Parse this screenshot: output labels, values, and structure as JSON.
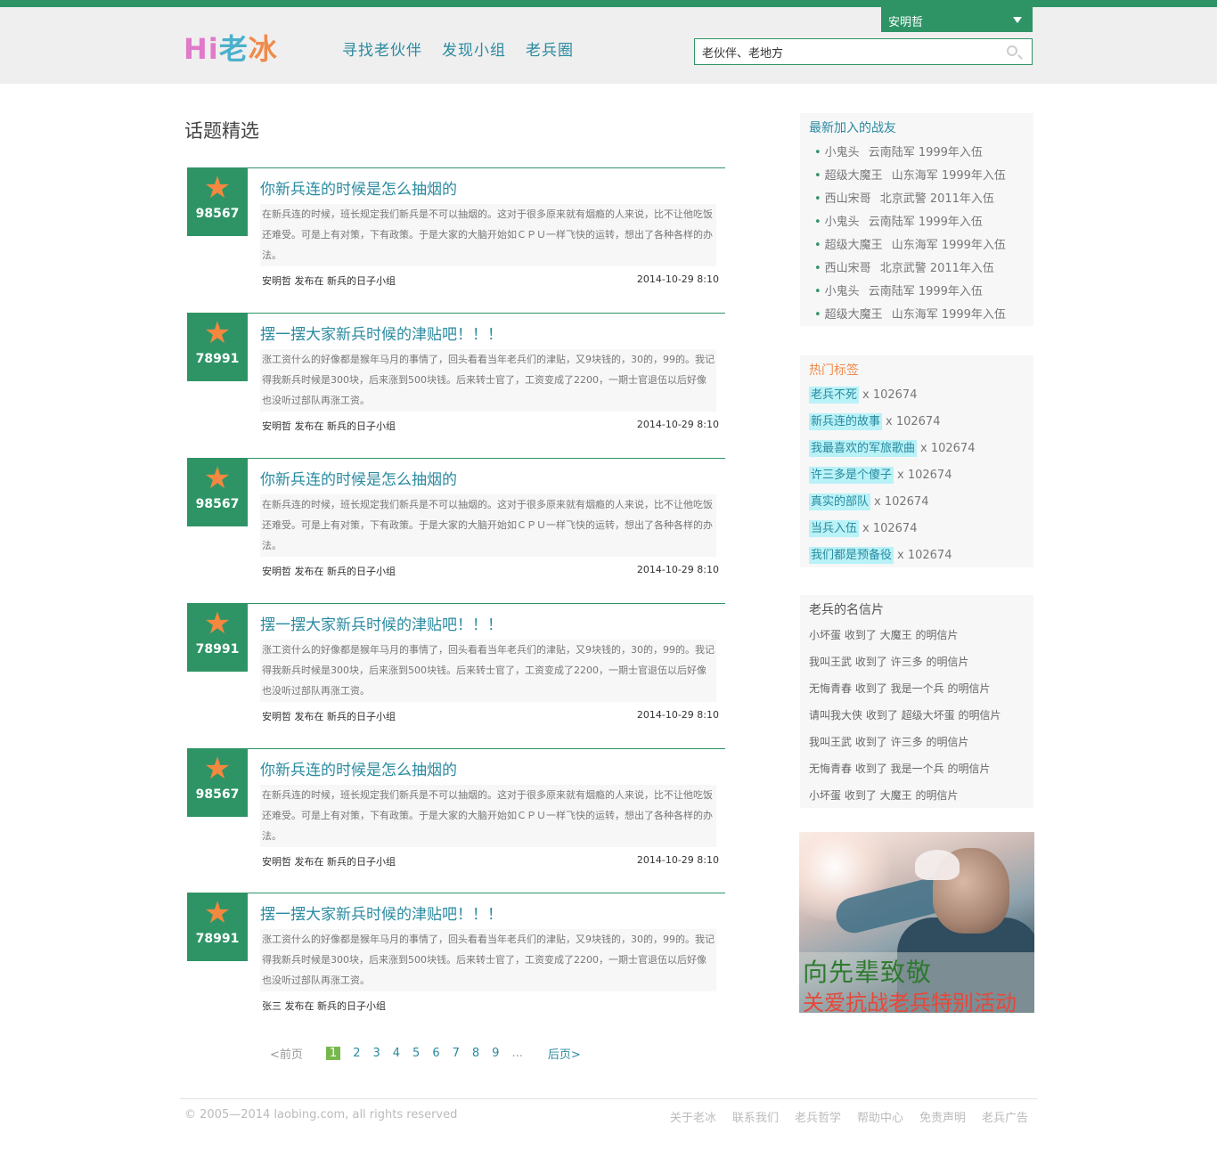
{
  "header": {
    "logo": {
      "hi": "Hi",
      "lao": "老",
      "bing": "冰"
    },
    "nav": [
      "寻找老伙伴",
      "发现小组",
      "老兵圈"
    ],
    "user": "安明哲",
    "search_value": "老伙伴、老地方"
  },
  "main": {
    "section_title": "话题精选",
    "topics": [
      {
        "count": "98567",
        "title": "你新兵连的时候是怎么抽烟的",
        "excerpt": "在新兵连的时候，班长规定我们新兵是不可以抽烟的。这对于很多原来就有烟瘾的人来说，比不让他吃饭还难受。可是上有对策，下有政策。于是大家的大脑开始如ＣＰＵ一样飞快的运转，想出了各种各样的办法。",
        "meta": "安明哲 发布在 新兵的日子小组",
        "date": "2014-10-29 8:10"
      },
      {
        "count": "78991",
        "title": "摆一摆大家新兵时候的津贴吧！！！",
        "excerpt": "涨工资什么的好像都是猴年马月的事情了，回头看看当年老兵们的津贴，又9块钱的，30的，99的。我记得我新兵时候是300块，后来涨到500块钱。后来转士官了，工资变成了2200，一期士官退伍以后好像也没听过部队再涨工资。",
        "meta": "安明哲 发布在 新兵的日子小组",
        "date": "2014-10-29 8:10"
      },
      {
        "count": "98567",
        "title": "你新兵连的时候是怎么抽烟的",
        "excerpt": "在新兵连的时候，班长规定我们新兵是不可以抽烟的。这对于很多原来就有烟瘾的人来说，比不让他吃饭还难受。可是上有对策，下有政策。于是大家的大脑开始如ＣＰＵ一样飞快的运转，想出了各种各样的办法。",
        "meta": "安明哲 发布在 新兵的日子小组",
        "date": "2014-10-29 8:10"
      },
      {
        "count": "78991",
        "title": "摆一摆大家新兵时候的津贴吧！！！",
        "excerpt": "涨工资什么的好像都是猴年马月的事情了，回头看看当年老兵们的津贴，又9块钱的，30的，99的。我记得我新兵时候是300块，后来涨到500块钱。后来转士官了，工资变成了2200，一期士官退伍以后好像也没听过部队再涨工资。",
        "meta": "安明哲 发布在 新兵的日子小组",
        "date": "2014-10-29 8:10"
      },
      {
        "count": "98567",
        "title": "你新兵连的时候是怎么抽烟的",
        "excerpt": "在新兵连的时候，班长规定我们新兵是不可以抽烟的。这对于很多原来就有烟瘾的人来说，比不让他吃饭还难受。可是上有对策，下有政策。于是大家的大脑开始如ＣＰＵ一样飞快的运转，想出了各种各样的办法。",
        "meta": "安明哲 发布在 新兵的日子小组",
        "date": "2014-10-29 8:10"
      },
      {
        "count": "78991",
        "title": "摆一摆大家新兵时候的津贴吧！！！",
        "excerpt": "涨工资什么的好像都是猴年马月的事情了，回头看看当年老兵们的津贴，又9块钱的，30的，99的。我记得我新兵时候是300块，后来涨到500块钱。后来转士官了，工资变成了2200，一期士官退伍以后好像也没听过部队再涨工资。",
        "meta": "张三 发布在 新兵的日子小组",
        "date": ""
      }
    ],
    "pager": {
      "prev": "<前页",
      "pages": [
        "1",
        "2",
        "3",
        "4",
        "5",
        "6",
        "7",
        "8",
        "9"
      ],
      "current": "1",
      "dots": "...",
      "next": "后页>"
    }
  },
  "sidebar": {
    "newest": {
      "title": "最新加入的战友",
      "items": [
        {
          "name": "小鬼头",
          "info": "云南陆军 1999年入伍"
        },
        {
          "name": "超级大魔王",
          "info": "山东海军 1999年入伍"
        },
        {
          "name": "西山宋哥",
          "info": "北京武警 2011年入伍"
        },
        {
          "name": "小鬼头",
          "info": "云南陆军 1999年入伍"
        },
        {
          "name": "超级大魔王",
          "info": "山东海军 1999年入伍"
        },
        {
          "name": "西山宋哥",
          "info": "北京武警 2011年入伍"
        },
        {
          "name": "小鬼头",
          "info": "云南陆军 1999年入伍"
        },
        {
          "name": "超级大魔王",
          "info": "山东海军 1999年入伍"
        }
      ]
    },
    "tags": {
      "title": "热门标签",
      "items": [
        {
          "tag": "老兵不死",
          "count": "x 102674"
        },
        {
          "tag": "新兵连的故事",
          "count": "x 102674"
        },
        {
          "tag": "我最喜欢的军旅歌曲",
          "count": "x 102674"
        },
        {
          "tag": "许三多是个傻子",
          "count": "x 102674"
        },
        {
          "tag": "真实的部队",
          "count": "x 102674"
        },
        {
          "tag": "当兵入伍",
          "count": "x 102674"
        },
        {
          "tag": "我们都是预备役",
          "count": "x 102674"
        }
      ]
    },
    "cards": {
      "title": "老兵的名信片",
      "items": [
        "小坏蛋 收到了 大魔王 的明信片",
        "我叫王武 收到了 许三多 的明信片",
        "无悔青春 收到了 我是一个兵 的明信片",
        "请叫我大侠 收到了 超级大坏蛋 的明信片",
        "我叫王武 收到了 许三多 的明信片",
        "无悔青春 收到了 我是一个兵 的明信片",
        "小坏蛋 收到了 大魔王 的明信片"
      ]
    },
    "banner": {
      "line1": "向先辈致敬",
      "line2": "关爱抗战老兵特别活动"
    }
  },
  "footer": {
    "copyright": "© 2005—2014 laobing.com, all rights reserved",
    "links": [
      "关于老冰",
      "联系我们",
      "老兵哲学",
      "帮助中心",
      "免责声明",
      "老兵广告"
    ]
  },
  "colors": {
    "brand_green": "#2e9466",
    "link_teal": "#2a8aa0",
    "star_orange": "#f5883e",
    "tag_bg": "#b9f2f7"
  }
}
